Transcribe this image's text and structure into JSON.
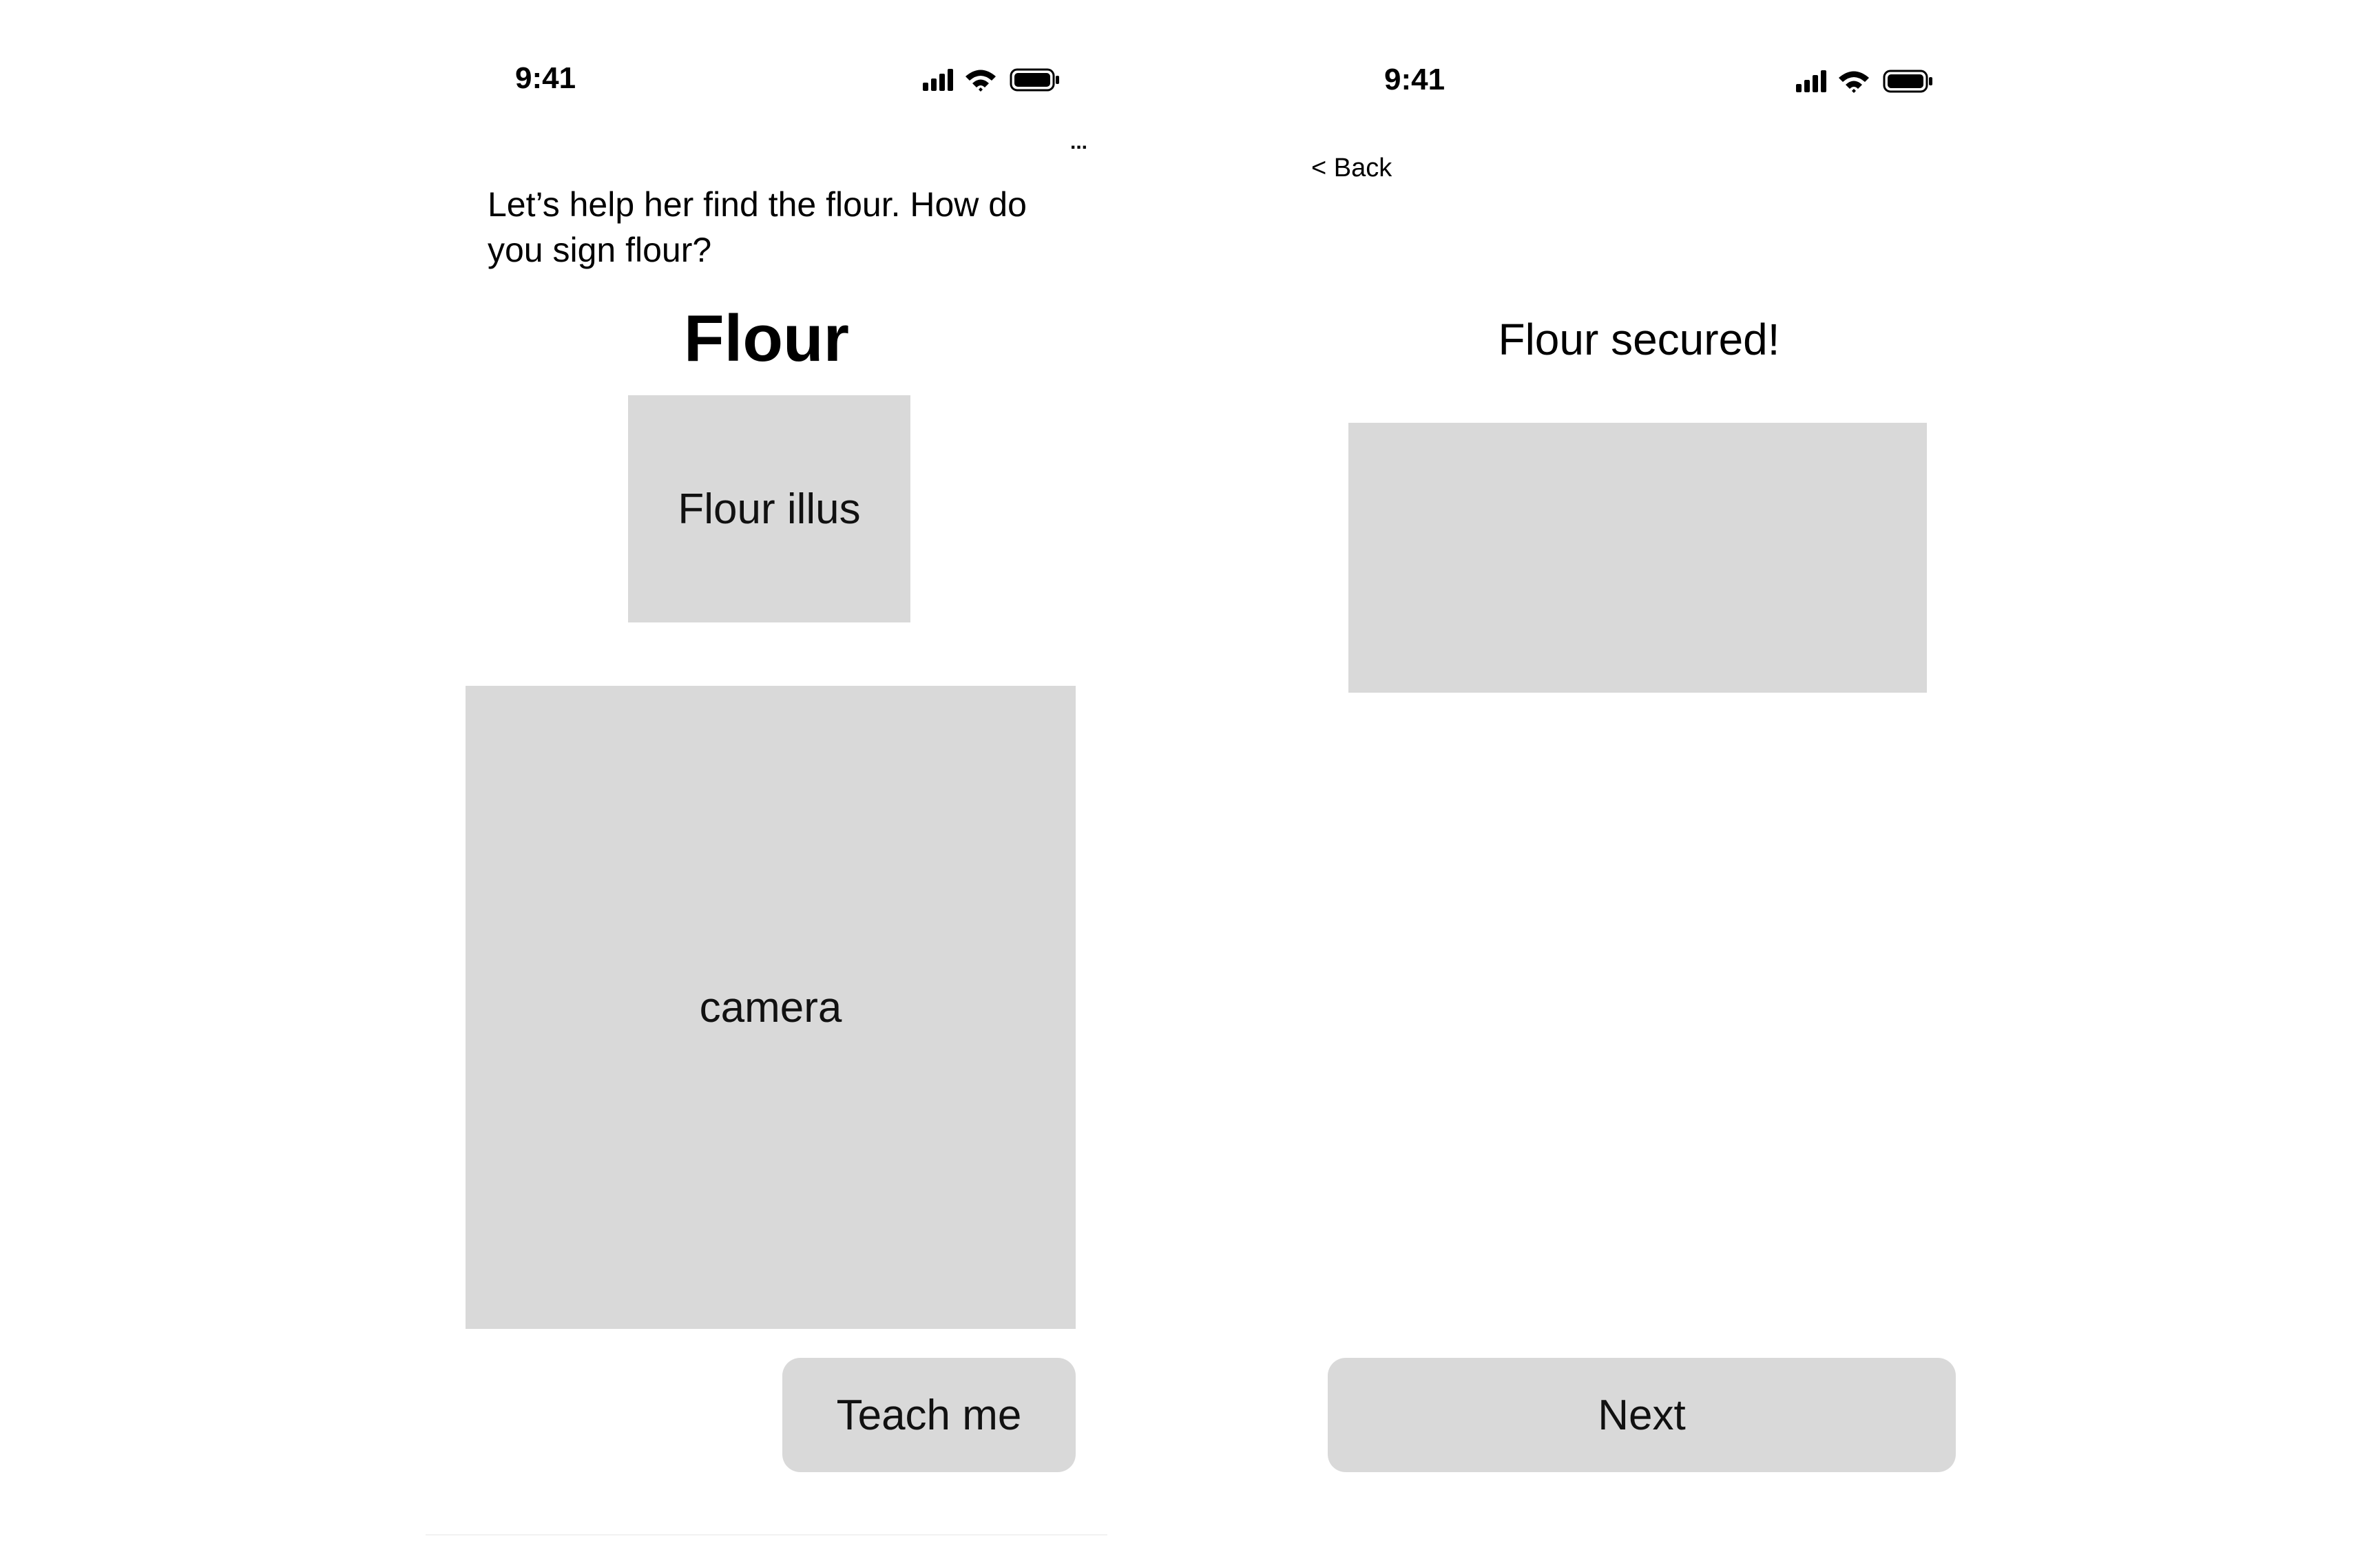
{
  "screens": [
    {
      "status_bar": {
        "time": "9:41"
      },
      "more_label": "...",
      "prompt": "Let’s help her find the flour. How do you sign flour?",
      "word": "Flour",
      "illustration_label": "Flour illus",
      "camera_label": "camera",
      "teach_button": "Teach me"
    },
    {
      "status_bar": {
        "time": "9:41"
      },
      "back_label": "< Back",
      "title": "Flour secured!",
      "next_button": "Next"
    }
  ],
  "colors": {
    "placeholder": "#d9d9d9",
    "background": "#ffffff",
    "text": "#000000"
  },
  "icons": [
    "signal-icon",
    "wifi-icon",
    "battery-icon"
  ]
}
